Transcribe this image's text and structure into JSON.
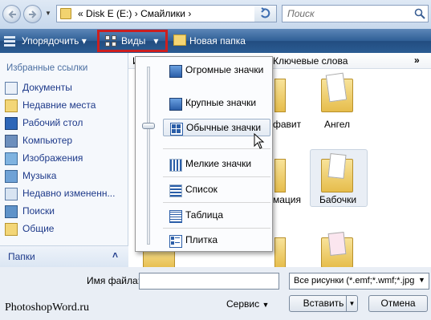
{
  "address": {
    "path_prefix": "«",
    "segment1": "Disk E (E:)",
    "separator": "›",
    "segment2": "Смайлики",
    "dropdown_arrow": "▾"
  },
  "search": {
    "placeholder": "Поиск"
  },
  "toolbar": {
    "organize": "Упорядочить",
    "views": "Виды",
    "new_folder": "Новая папка",
    "arrow": "▾"
  },
  "sidebar": {
    "heading": "Избранные ссылки",
    "items": [
      {
        "label": "Документы",
        "icon": "documents-icon"
      },
      {
        "label": "Недавние места",
        "icon": "recent-places-icon"
      },
      {
        "label": "Рабочий стол",
        "icon": "desktop-icon"
      },
      {
        "label": "Компьютер",
        "icon": "computer-icon"
      },
      {
        "label": "Изображения",
        "icon": "pictures-icon"
      },
      {
        "label": "Музыка",
        "icon": "music-icon"
      },
      {
        "label": "Недавно измененн...",
        "icon": "recently-changed-icon"
      },
      {
        "label": "Поиски",
        "icon": "searches-icon"
      },
      {
        "label": "Общие",
        "icon": "public-icon"
      }
    ],
    "folders": "Папки",
    "folders_chevron": "˄"
  },
  "columns": {
    "first": "И",
    "keywords": "Ключевые слова",
    "more": "»"
  },
  "files": [
    {
      "label": "фавит"
    },
    {
      "label": "Ангел"
    },
    {
      "label": "мация"
    },
    {
      "label": "Бабочки"
    }
  ],
  "views_menu": {
    "items": [
      {
        "label": "Огромные значки",
        "icon": "extra-large-icons-icon"
      },
      {
        "label": "Крупные значки",
        "icon": "large-icons-icon"
      },
      {
        "label": "Обычные значки",
        "icon": "medium-icons-icon",
        "selected": true
      },
      {
        "label": "Мелкие значки",
        "icon": "small-icons-icon"
      },
      {
        "label": "Список",
        "icon": "list-icon"
      },
      {
        "label": "Таблица",
        "icon": "details-icon"
      },
      {
        "label": "Плитка",
        "icon": "tiles-icon"
      }
    ]
  },
  "footer": {
    "filename_label": "Имя файла:",
    "filename_value": "",
    "filter": "Все рисунки (*.emf;*.wmf;*.jpg;*",
    "service": "Сервис",
    "insert": "Вставить",
    "cancel": "Отмена"
  },
  "watermark": "PhotoshopWord.ru"
}
